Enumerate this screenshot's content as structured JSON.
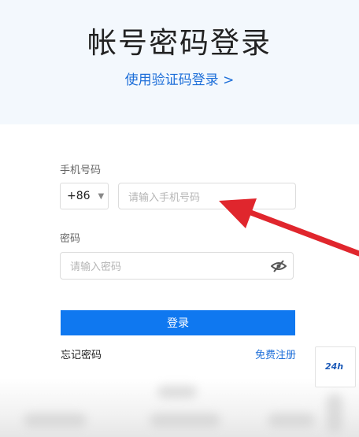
{
  "header": {
    "title": "帐号密码登录",
    "switch_link": "使用验证码登录 >"
  },
  "form": {
    "phone_label": "手机号码",
    "country_code": "+86",
    "phone_placeholder": "请输入手机号码",
    "password_label": "密码",
    "password_placeholder": "请输入密码",
    "login_button": "登录",
    "forgot_password": "忘记密码",
    "register": "免费注册"
  },
  "widget": {
    "label": "24h",
    "icon": "support-24h-icon"
  },
  "colors": {
    "header_bg": "#f3f8fd",
    "accent": "#1e6fd9",
    "button": "#0f78f0",
    "annotation_arrow": "#e0262d"
  },
  "icons": {
    "password_visibility": "eye-hidden-icon",
    "country_dropdown": "caret-down-icon"
  }
}
